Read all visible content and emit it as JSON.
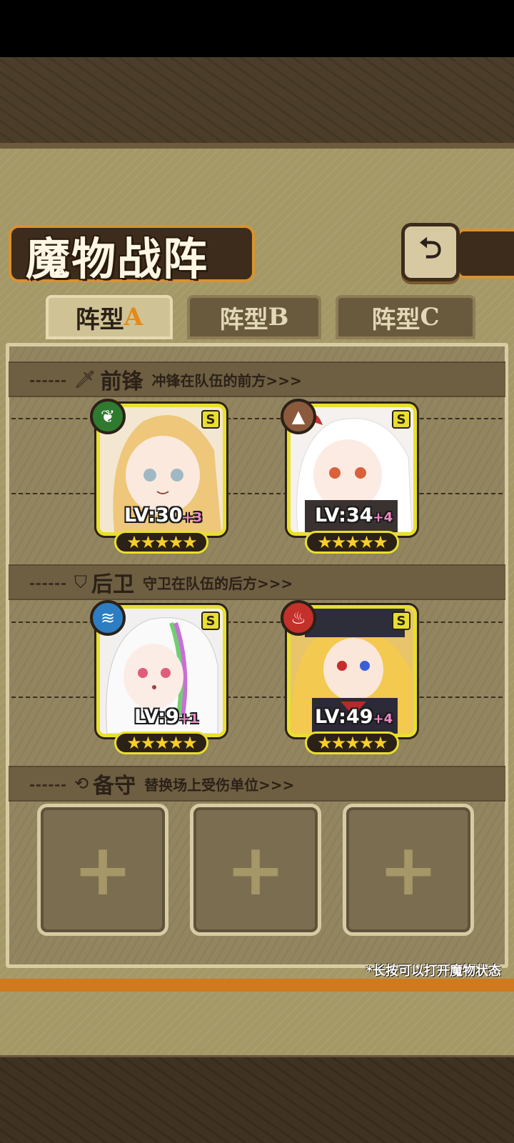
{
  "title": "魔物战阵",
  "back_icon": "return-arrow-icon",
  "tabs": [
    {
      "label": "阵型",
      "letter": "A",
      "active": true
    },
    {
      "label": "阵型",
      "letter": "B",
      "active": false
    },
    {
      "label": "阵型",
      "letter": "C",
      "active": false
    }
  ],
  "sections": {
    "front": {
      "title": "前锋",
      "desc": "冲锋在队伍的前方>>>",
      "icon": "sword-icon"
    },
    "rear": {
      "title": "后卫",
      "desc": "守卫在队伍的后方>>>",
      "icon": "shield-icon"
    },
    "reserve": {
      "title": "备守",
      "desc": "替换场上受伤单位>>>",
      "icon": "swap-icon"
    }
  },
  "units": {
    "front1": {
      "level": "LV:30",
      "plus": "+3",
      "rank": "S",
      "element": "leaf",
      "stars": "★★★★★",
      "element_color": "#2f7a2f"
    },
    "front2": {
      "level": "LV:34",
      "plus": "+4",
      "rank": "S",
      "element": "earth",
      "stars": "★★★★★",
      "element_color": "#8b5a3c"
    },
    "rear1": {
      "level": "LV:9",
      "plus": "+1",
      "rank": "S",
      "element": "water",
      "stars": "★★★★★",
      "element_color": "#2c7dc2"
    },
    "rear2": {
      "level": "LV:49",
      "plus": "+4",
      "rank": "S",
      "element": "fire",
      "stars": "★★★★★",
      "element_color": "#c4302a"
    }
  },
  "reserve_slot": "+",
  "hint": "*长按可以打开魔物状态"
}
